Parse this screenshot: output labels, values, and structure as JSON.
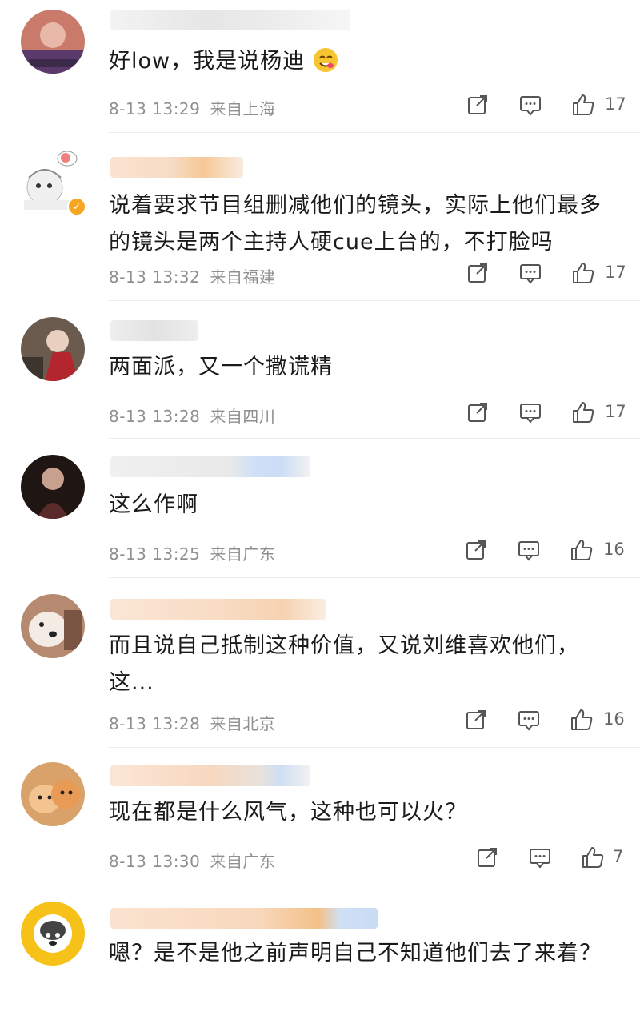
{
  "comments": [
    {
      "text": "好low，我是说杨迪",
      "date": "8-13 13:29",
      "location": "来自上海",
      "likes": "17",
      "emoji": "yum-face-icon"
    },
    {
      "text": "说着要求节目组删减他们的镜头，实际上他们最多的镜头是两个主持人硬cue上台的，不打脸吗",
      "date": "8-13 13:32",
      "location": "来自福建",
      "likes": "17"
    },
    {
      "text": "两面派，又一个撒谎精",
      "date": "8-13 13:28",
      "location": "来自四川",
      "likes": "17"
    },
    {
      "text": "这么作啊",
      "date": "8-13 13:25",
      "location": "来自广东",
      "likes": "16"
    },
    {
      "text": "而且说自己抵制这种价值，又说刘维喜欢他们，这...",
      "date": "8-13 13:28",
      "location": "来自北京",
      "likes": "16"
    },
    {
      "text": "现在都是什么风气，这种也可以火？",
      "date": "8-13 13:30",
      "location": "来自广东",
      "likes": "7"
    },
    {
      "text": "嗯？是不是他之前声明自己不知道他们去了来着？",
      "date": "",
      "location": "",
      "likes": ""
    }
  ],
  "icons": {
    "share": "share-icon",
    "comment": "comment-icon",
    "like": "like-icon"
  }
}
